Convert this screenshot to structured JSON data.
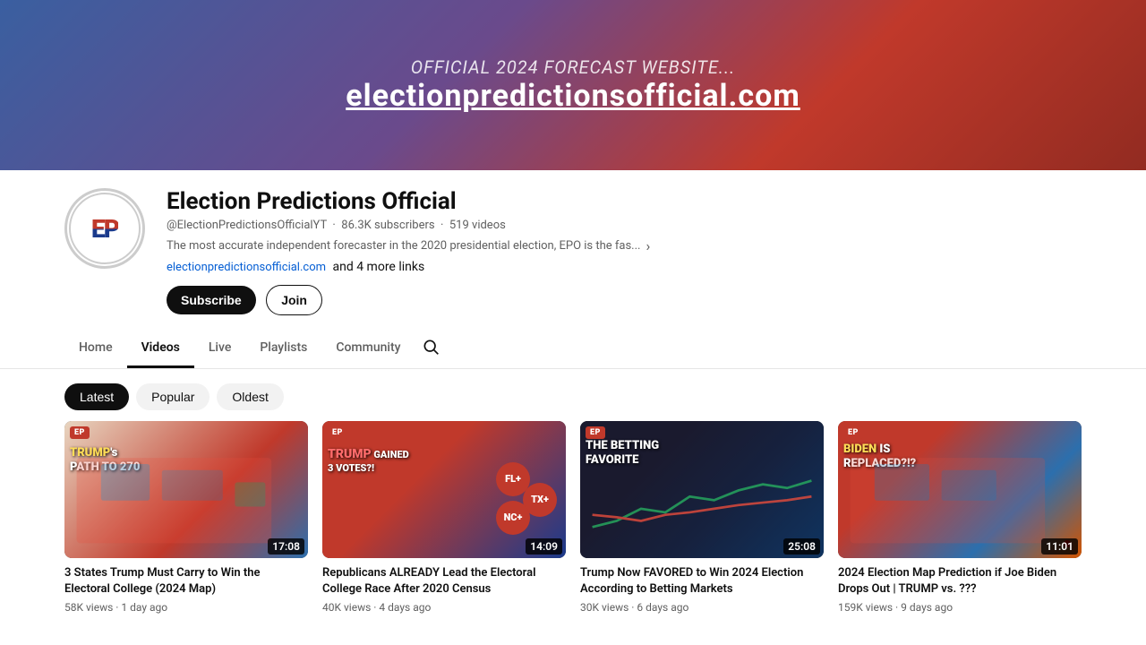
{
  "banner": {
    "subtitle": "OFFICIAL 2024 FORECAST WEBSITE...",
    "url": "electionpredictionsofficial.com"
  },
  "channel": {
    "name": "Election Predictions Official",
    "handle": "@ElectionPredictionsOfficialYT",
    "subscribers": "86.3K subscribers",
    "videos": "519 videos",
    "description": "The most accurate independent forecaster in the 2020 presidential election, EPO is the fas...",
    "link_text": "electionpredictionsofficial.com",
    "link_extra": "and 4 more links",
    "subscribe_label": "Subscribe",
    "join_label": "Join",
    "avatar_text": "EP"
  },
  "nav": {
    "tabs": [
      {
        "label": "Home",
        "active": false
      },
      {
        "label": "Videos",
        "active": true
      },
      {
        "label": "Live",
        "active": false
      },
      {
        "label": "Playlists",
        "active": false
      },
      {
        "label": "Community",
        "active": false
      }
    ]
  },
  "filters": [
    {
      "label": "Latest",
      "active": true
    },
    {
      "label": "Popular",
      "active": false
    },
    {
      "label": "Oldest",
      "active": false
    }
  ],
  "videos": [
    {
      "title": "3 States Trump Must Carry to Win the Electoral College (2024 Map)",
      "views": "58K views",
      "age": "1 day ago",
      "duration": "17:08",
      "badge": "EP",
      "thumb_label": "TRUMP's PATH TO 270",
      "overlay1": "TRUMP's",
      "overlay2": "PATH TO 270"
    },
    {
      "title": "Republicans ALREADY Lead the Electoral College Race After 2020 Census",
      "views": "40K views",
      "age": "4 days ago",
      "duration": "14:09",
      "badge": "EP",
      "overlay1": "TRUMP GAINED 3 VOTES?!",
      "overlay2": "FL+",
      "overlay3": "TX+",
      "overlay4": "NC+"
    },
    {
      "title": "Trump Now FAVORED to Win 2024 Election According to Betting Markets",
      "views": "30K views",
      "age": "6 days ago",
      "duration": "25:08",
      "badge": "EP",
      "overlay1": "THE BETTING FAVORITE"
    },
    {
      "title": "2024 Election Map Prediction if Joe Biden Drops Out | TRUMP vs. ???",
      "views": "159K views",
      "age": "9 days ago",
      "duration": "11:01",
      "badge": "EP",
      "overlay1": "BIDEN IS REPLACED?!?"
    }
  ]
}
